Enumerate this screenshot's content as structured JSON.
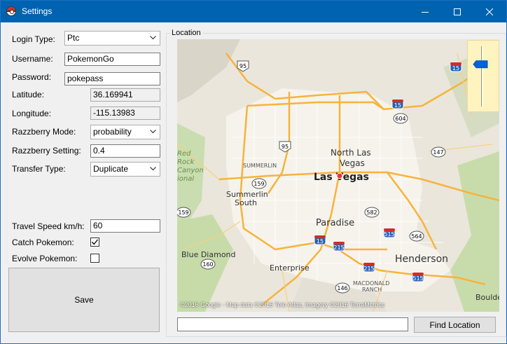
{
  "window": {
    "title": "Settings"
  },
  "form": {
    "login_type": {
      "label": "Login Type:",
      "value": "Ptc"
    },
    "username": {
      "label": "Username:",
      "value": "PokemonGo"
    },
    "password": {
      "label": "Password:",
      "value": "pokepass"
    },
    "latitude": {
      "label": "Latitude:",
      "value": "36.169941"
    },
    "longitude": {
      "label": "Longitude:",
      "value": "-115.13983"
    },
    "razzberry_mode": {
      "label": "Razzberry Mode:",
      "value": "probability"
    },
    "razzberry_setting": {
      "label": "Razzberry Setting:",
      "value": "0.4"
    },
    "transfer_type": {
      "label": "Transfer Type:",
      "value": "Duplicate"
    },
    "travel_speed": {
      "label": "Travel Speed km/h:",
      "value": "60"
    },
    "catch_pokemon": {
      "label": "Catch Pokemon:",
      "checked": true
    },
    "evolve_pokemon": {
      "label": "Evolve Pokemon:",
      "checked": false
    },
    "save_label": "Save"
  },
  "location": {
    "group_label": "Location",
    "search_value": "",
    "find_label": "Find Location",
    "copyright": "©2016 Google - Map data ©2016 Tele Atlas, Imagery ©2016 TerraMetrics",
    "zoom_level": 0.7,
    "places": {
      "las_vegas": "Las Vegas",
      "north_las_vegas_1": "North Las",
      "north_las_vegas_2": "Vegas",
      "paradise": "Paradise",
      "henderson": "Henderson",
      "summerlin": "SUMMERLIN",
      "summerlin_south_1": "Summerlin",
      "summerlin_south_2": "South",
      "blue_diamond": "Blue Diamond",
      "enterprise": "Enterprise",
      "macdonald_1": "MACDONALD",
      "macdonald_2": "RANCH",
      "red_rock_1": "Red",
      "red_rock_2": "Rock",
      "red_rock_3": "Canyon",
      "red_rock_4": "ional",
      "boulder": "Boulde"
    },
    "shields": {
      "i15_north": "15",
      "i15_mid": "15",
      "i15_south": "15",
      "us95_north": "95",
      "us95_mid": "95",
      "r604": "604",
      "r147": "147",
      "r159_a": "159",
      "r159_b": "159",
      "r160": "160",
      "r582": "582",
      "r515_a": "515",
      "r515_b": "515",
      "r564": "564",
      "r215_a": "215",
      "r215_b": "215",
      "r146": "146"
    }
  }
}
